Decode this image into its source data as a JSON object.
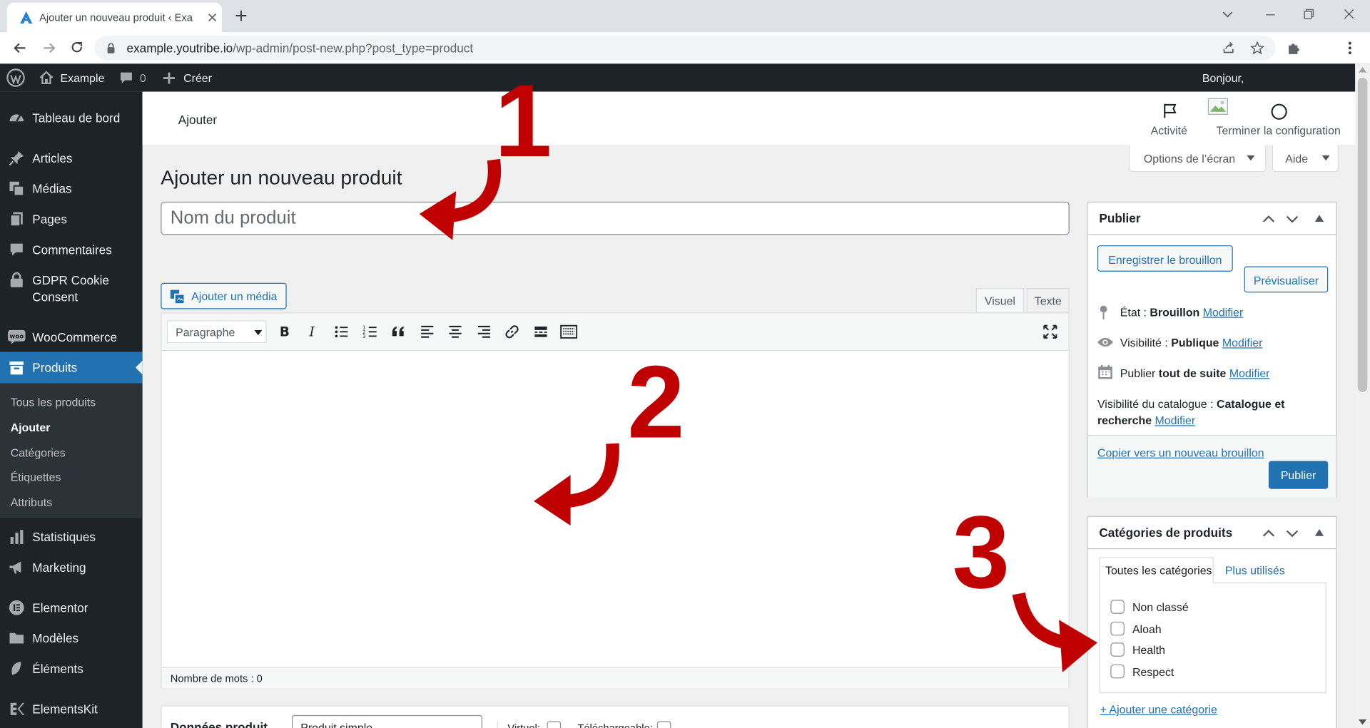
{
  "browser": {
    "tab_title": "Ajouter un nouveau produit ‹ Exa",
    "url_host": "example.youtribe.io",
    "url_path": "/wp-admin/post-new.php?post_type=product"
  },
  "adminbar": {
    "site_name": "Example",
    "comments_count": "0",
    "new_label": "Créer",
    "greeting": "Bonjour,"
  },
  "sidebar": {
    "items": [
      {
        "label": "Tableau de bord",
        "icon": "dashboard-icon"
      },
      {
        "label": "Articles",
        "icon": "pin-icon"
      },
      {
        "label": "Médias",
        "icon": "media-icon"
      },
      {
        "label": "Pages",
        "icon": "pages-icon"
      },
      {
        "label": "Commentaires",
        "icon": "comment-icon"
      },
      {
        "label": "GDPR Cookie Consent",
        "icon": "lock-icon"
      },
      {
        "label": "WooCommerce",
        "icon": "woo-icon"
      },
      {
        "label": "Produits",
        "icon": "archive-icon"
      },
      {
        "label": "Statistiques",
        "icon": "bar-chart-icon"
      },
      {
        "label": "Marketing",
        "icon": "megaphone-icon"
      },
      {
        "label": "Elementor",
        "icon": "elementor-icon"
      },
      {
        "label": "Modèles",
        "icon": "folder-icon"
      },
      {
        "label": "Éléments",
        "icon": "leaf-icon"
      },
      {
        "label": "ElementsKit",
        "icon": "elementskit-icon"
      }
    ],
    "submenu": [
      "Tous les produits",
      "Ajouter",
      "Catégories",
      "Étiquettes",
      "Attributs"
    ]
  },
  "header": {
    "title": "Ajouter",
    "activity": "Activité",
    "finish_setup": "Terminer la configuration"
  },
  "screen_options": "Options de l’écran",
  "help": "Aide",
  "page_title": "Ajouter un nouveau produit",
  "title_placeholder": "Nom du produit",
  "add_media": "Ajouter un média",
  "editor": {
    "tab_visual": "Visuel",
    "tab_text": "Texte",
    "format": "Paragraphe",
    "word_count": "Nombre de mots : 0"
  },
  "product_data": {
    "label": "Données produit",
    "type": "Produit simple",
    "virtual": "Virtuel:",
    "downloadable": "Téléchargeable:"
  },
  "publish_box": {
    "title": "Publier",
    "save_draft": "Enregistrer le brouillon",
    "preview": "Prévisualiser",
    "status_label": "État :",
    "status_value": "Brouillon",
    "visibility_label": "Visibilité :",
    "visibility_value": "Publique",
    "publish_label": "Publier",
    "publish_value": "tout de suite",
    "catalog_label": "Visibilité du catalogue :",
    "catalog_value": "Catalogue et",
    "catalog_value2": "recherche",
    "modify": "Modifier",
    "copy_draft": "Copier vers un nouveau brouillon",
    "publish_button": "Publier"
  },
  "categories_box": {
    "title": "Catégories de produits",
    "tab_all": "Toutes les catégories",
    "tab_popular": "Plus utilisés",
    "items": [
      "Non classé",
      "Aloah",
      "Health",
      "Respect"
    ],
    "add_new": "+ Ajouter une catégorie"
  },
  "annotations": [
    "1",
    "2",
    "3"
  ],
  "colors": {
    "admin_dark": "#1d2327",
    "admin_blue": "#2271b1",
    "annotation_red": "#c00000"
  }
}
